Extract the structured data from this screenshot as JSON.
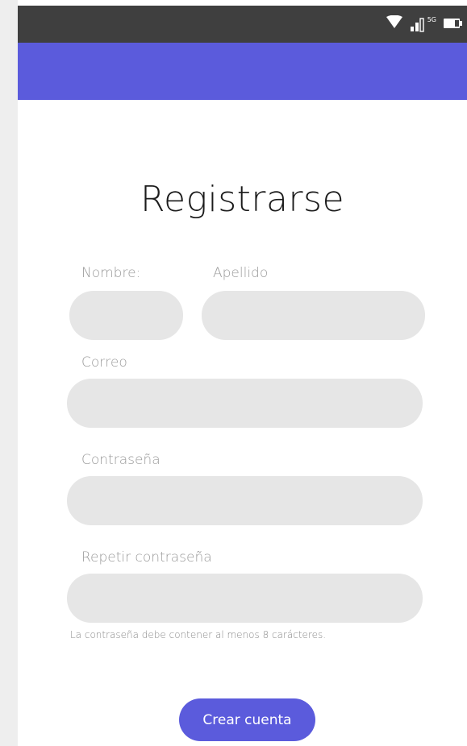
{
  "status_bar": {
    "icons": [
      "wifi-icon",
      "signal-icon",
      "battery-icon"
    ],
    "network_label": "5G"
  },
  "form": {
    "title": "Registrarse",
    "first_name_label": "Nombre:",
    "last_name_label": "Apellido",
    "email_label": "Correo",
    "password_label": "Contraseña",
    "repeat_password_label": "Repetir contraseña",
    "password_hint": "La contraseña debe contener al menos 8 carácteres.",
    "first_name_value": "",
    "last_name_value": "",
    "email_value": "",
    "password_value": "",
    "repeat_password_value": "",
    "submit_label": "Crear cuenta"
  },
  "colors": {
    "accent": "#5b5bdc",
    "status_bar": "#3f3f3f",
    "field_background": "#e6e6e6",
    "label_text": "#9a9a9a"
  }
}
